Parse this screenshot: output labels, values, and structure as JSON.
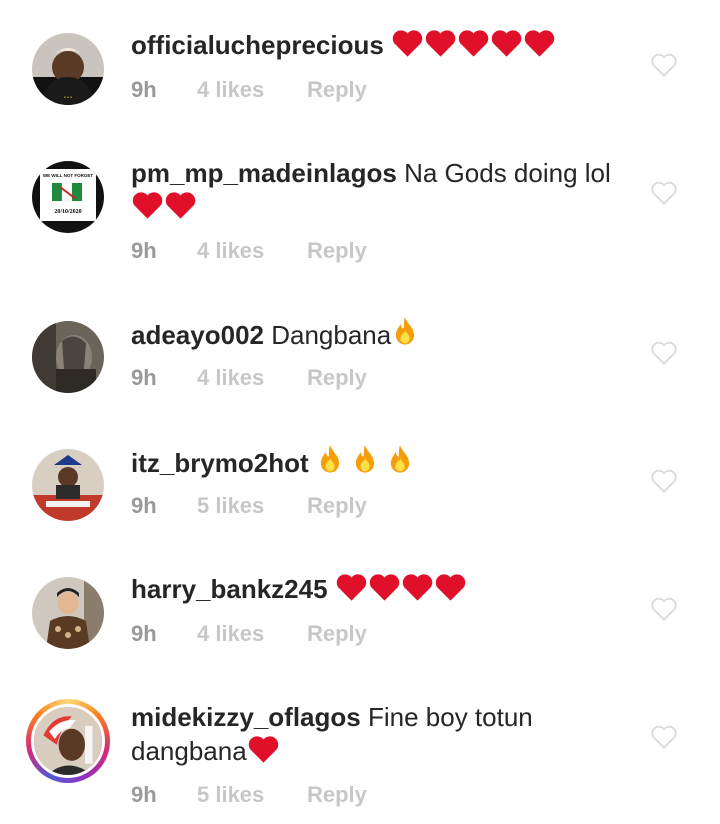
{
  "comments": [
    {
      "username": "officialucheprecious",
      "text": "❤️❤️❤️❤️❤️",
      "time": "9h",
      "likes": "4 likes",
      "reply": "Reply"
    },
    {
      "username": "pm_mp_madeinlagos",
      "text": "Na Gods doing lol❤️❤️",
      "time": "9h",
      "likes": "4 likes",
      "reply": "Reply",
      "avatar_text": "WE WILL NOT FORGET",
      "avatar_date": "20/10/2020"
    },
    {
      "username": "adeayo002",
      "text": "Dangbana🔥",
      "time": "9h",
      "likes": "4 likes",
      "reply": "Reply"
    },
    {
      "username": "itz_brymo2hot",
      "text": "🔥🔥🔥",
      "time": "9h",
      "likes": "5 likes",
      "reply": "Reply"
    },
    {
      "username": "harry_bankz245",
      "text": "❤️❤️❤️❤️",
      "time": "9h",
      "likes": "4 likes",
      "reply": "Reply"
    },
    {
      "username": "midekizzy_oflagos",
      "text": "Fine boy totun dangbana❤️",
      "time": "9h",
      "likes": "5 likes",
      "reply": "Reply"
    }
  ],
  "colors": {
    "text": "#262626",
    "meta": "#8e8e8e",
    "meta_light": "#c7c7c7",
    "heart_red": "#e0102a",
    "flame_orange": "#f59e0b"
  },
  "icons": {
    "like": "heart-outline-icon",
    "heart_emoji": "red-heart-emoji",
    "fire_emoji": "fire-emoji"
  }
}
